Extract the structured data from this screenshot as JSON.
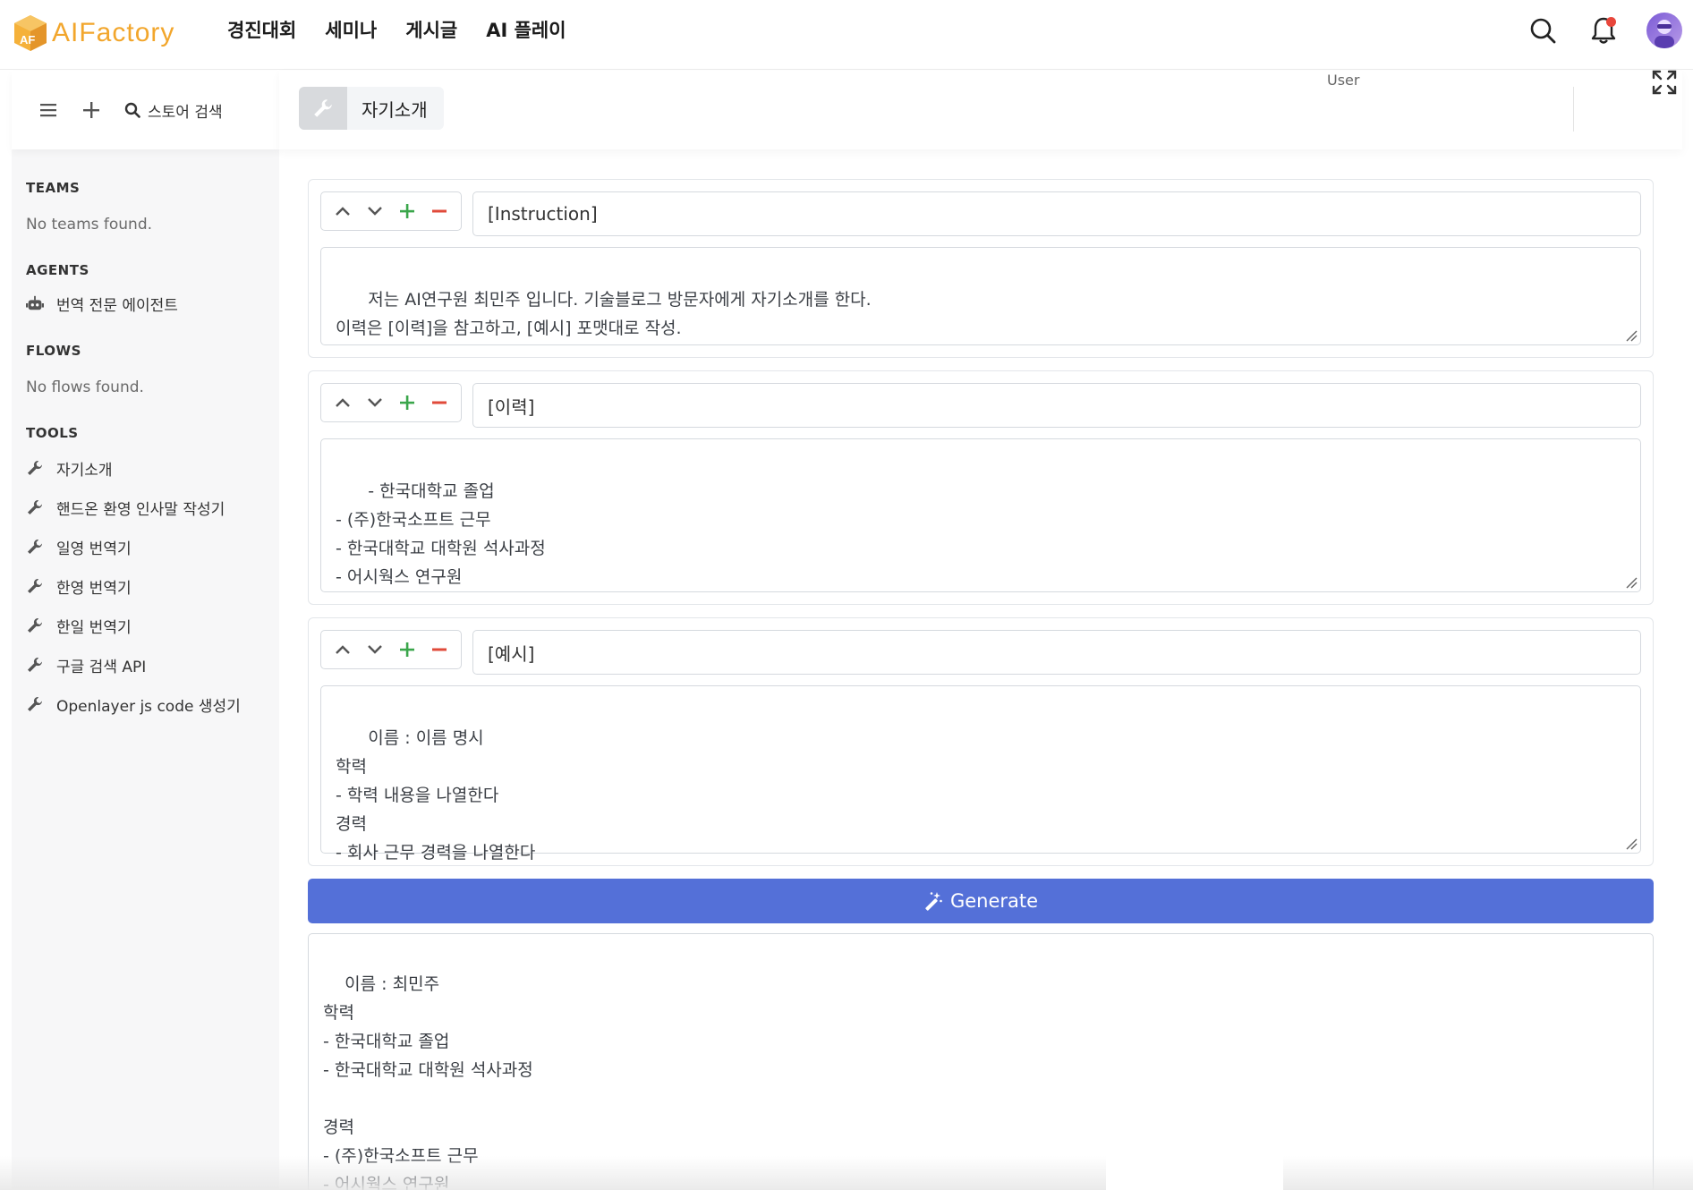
{
  "brand": {
    "name": "AIFactory"
  },
  "nav": {
    "items": [
      "경진대회",
      "세미나",
      "게시글",
      "AI 플레이"
    ]
  },
  "sidebar": {
    "search_label": "스토어 검색",
    "teams": {
      "heading": "TEAMS",
      "empty": "No teams found."
    },
    "agents": {
      "heading": "AGENTS",
      "items": [
        "번역 전문 에이전트"
      ]
    },
    "flows": {
      "heading": "FLOWS",
      "empty": "No flows found."
    },
    "tools": {
      "heading": "TOOLS",
      "items": [
        "자기소개",
        "핸드온 환영 인사말 작성기",
        "일영 번역기",
        "한영 번역기",
        "한일 번역기",
        "구글 검색 API",
        "Openlayer js code 생성기"
      ]
    }
  },
  "tab": {
    "label": "자기소개"
  },
  "header": {
    "user_label": "User"
  },
  "blocks": [
    {
      "title": "[Instruction]",
      "body": "저는 AI연구원 최민주 입니다. 기술블로그 방문자에게 자기소개를 한다.\n이력은 [이력]을 참고하고, [예시] 포맷대로 작성."
    },
    {
      "title": "[이력]",
      "body": "- 한국대학교 졸업\n- (주)한국소프트 근무\n- 한국대학교 대학원 석사과정\n- 어시웍스 연구원"
    },
    {
      "title": "[예시]",
      "body": "이름 : 이름 명시\n학력\n- 학력 내용을 나열한다\n경력\n- 회사 근무 경력을 나열한다"
    }
  ],
  "generate_label": "Generate",
  "output": "이름 : 최민주\n학력\n- 한국대학교 졸업\n- 한국대학교 대학원 석사과정\n\n경력\n- (주)한국소프트 근무\n- 어시웍스 연구원",
  "colors": {
    "primary": "#5470d8",
    "brand": "#f2a62c",
    "add": "#3aa64b",
    "remove": "#e04a3a"
  }
}
